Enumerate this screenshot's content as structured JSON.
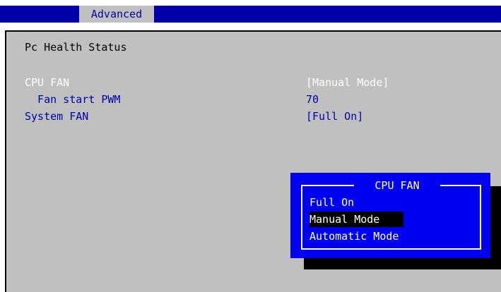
{
  "menu": {
    "active_tab": "Advanced"
  },
  "section": {
    "title": "Pc Health Status"
  },
  "settings": [
    {
      "label": "CPU FAN",
      "value": "[Manual Mode]"
    },
    {
      "label": "  Fan start PWM",
      "value": "70"
    },
    {
      "label": "System FAN",
      "value": "[Full On]"
    }
  ],
  "popup": {
    "title": "CPU FAN",
    "options": [
      "Full On",
      "Manual Mode",
      "Automatic Mode"
    ],
    "selected": "Manual Mode"
  },
  "colors": {
    "header_bar": "#0000a8",
    "panel_background": "#c0c0c0",
    "popup_background": "#0000f0",
    "highlight_text": "#ffffff",
    "setting_text": "#0000a8"
  }
}
